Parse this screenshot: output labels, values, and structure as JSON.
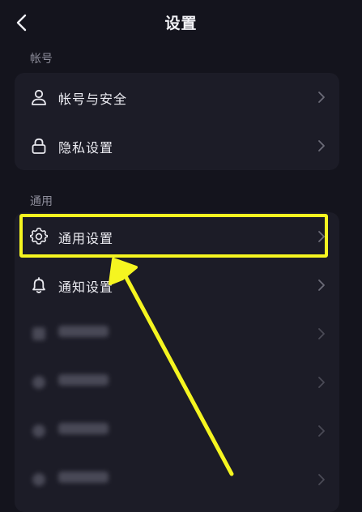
{
  "header": {
    "title": "设置"
  },
  "sections": {
    "account": {
      "label": "帐号"
    },
    "general": {
      "label": "通用"
    }
  },
  "account_items": [
    {
      "label": "帐号与安全",
      "icon": "person-icon"
    },
    {
      "label": "隐私设置",
      "icon": "lock-icon"
    }
  ],
  "general_items": [
    {
      "label": "通用设置",
      "icon": "gear-icon"
    },
    {
      "label": "通知设置",
      "icon": "bell-icon"
    }
  ],
  "colors": {
    "background": "#14141d",
    "card": "#1c1c27",
    "highlight": "#f5f520",
    "muted_text": "#8d8d9a"
  }
}
